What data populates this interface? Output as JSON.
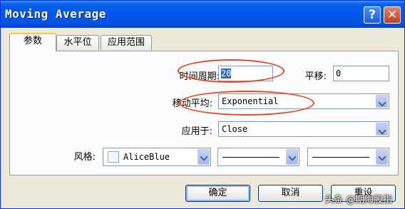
{
  "window": {
    "title": "Moving Average",
    "help_icon": "?",
    "close_icon": "✕"
  },
  "tabs": [
    {
      "label": "参数",
      "active": true
    },
    {
      "label": "水平位",
      "active": false
    },
    {
      "label": "应用范围",
      "active": false
    }
  ],
  "params": {
    "period_label": "时间周期:",
    "period_value": "20",
    "shift_label": "平移:",
    "shift_value": "0",
    "ma_method_label": "移动平均:",
    "ma_method_value": "Exponential",
    "apply_to_label": "应用于:",
    "apply_to_value": "Close",
    "style_label": "风格:",
    "color_value": "AliceBlue",
    "colors": {
      "swatch": "#f0f8ff",
      "annotation": "#e04a2a"
    }
  },
  "buttons": {
    "ok": "确定",
    "cancel": "取消",
    "reset": "重设"
  },
  "watermark": "头条 @期海股指"
}
